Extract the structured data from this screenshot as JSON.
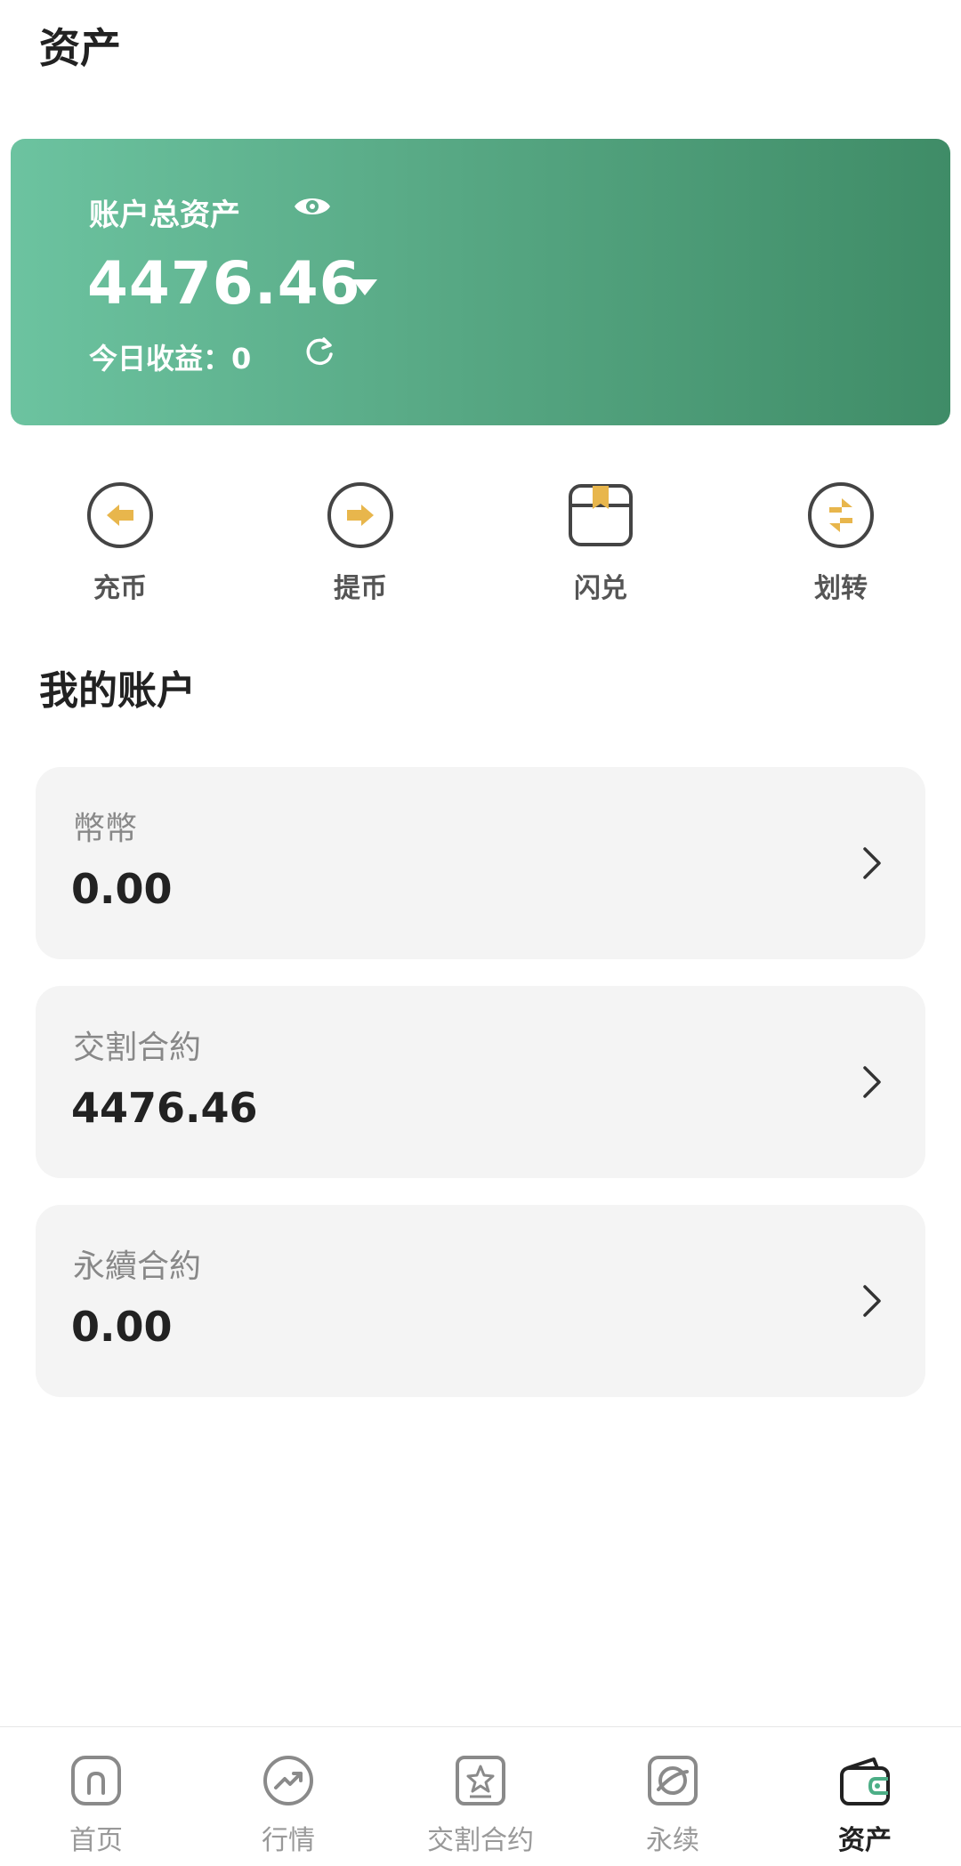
{
  "header": {
    "title": "资产"
  },
  "summary": {
    "label": "账户总资产",
    "total": "4476.46",
    "today_profit": "今日收益：0"
  },
  "actions": [
    {
      "label": "充币",
      "icon": "deposit-arrow-left-icon"
    },
    {
      "label": "提币",
      "icon": "withdraw-arrow-right-icon"
    },
    {
      "label": "闪兑",
      "icon": "flash-exchange-box-icon"
    },
    {
      "label": "划转",
      "icon": "transfer-swap-icon"
    }
  ],
  "accounts_section": {
    "title": "我的账户"
  },
  "accounts": [
    {
      "name": "幣幣",
      "value": "0.00"
    },
    {
      "name": "交割合約",
      "value": "4476.46"
    },
    {
      "name": "永續合約",
      "value": "0.00"
    }
  ],
  "tabbar": [
    {
      "label": "首页",
      "icon": "home-icon"
    },
    {
      "label": "行情",
      "icon": "market-trend-icon"
    },
    {
      "label": "交割合约",
      "icon": "delivery-contract-icon"
    },
    {
      "label": "永续",
      "icon": "perpetual-icon"
    },
    {
      "label": "资产",
      "icon": "wallet-icon",
      "active": true
    }
  ],
  "colors": {
    "card_gradient_start": "#6cc3a0",
    "card_gradient_end": "#3f8c67",
    "action_accent": "#e8b64c",
    "active_tab_accent": "#4cae86"
  }
}
